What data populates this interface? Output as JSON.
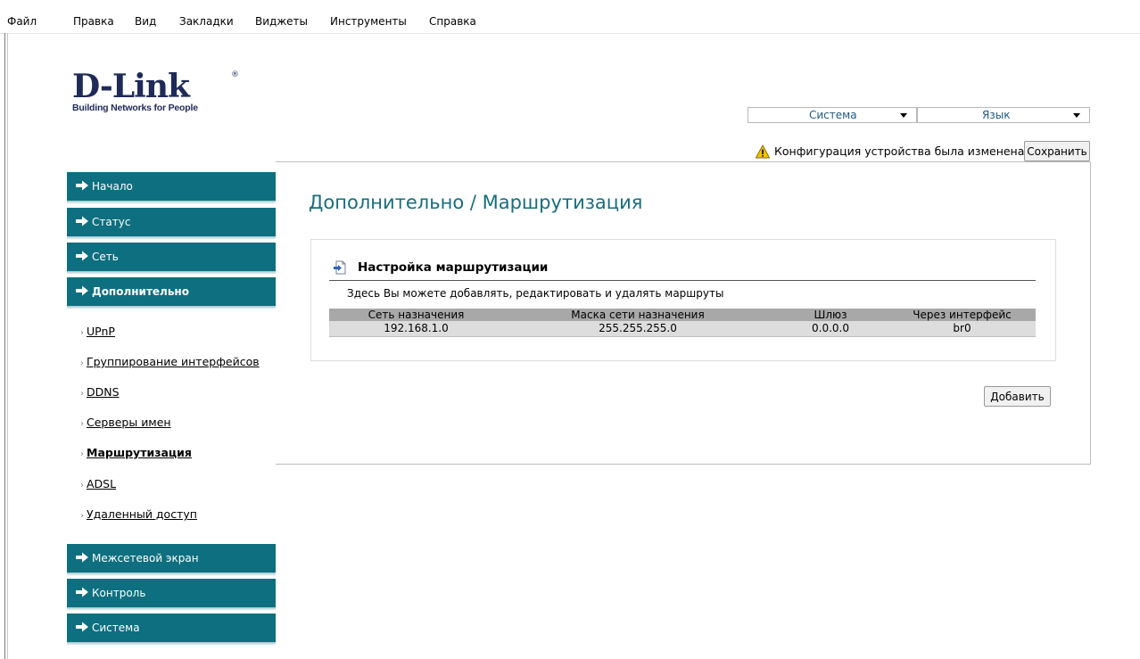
{
  "menubar": [
    "Файл",
    "Правка",
    "Вид",
    "Закладки",
    "Виджеты",
    "Инструменты",
    "Справка"
  ],
  "logo": {
    "brand": "D-Link",
    "reg": "®",
    "tagline": "Building Networks for People"
  },
  "top_selects": {
    "system": "Система",
    "language": "Язык"
  },
  "notice": {
    "text": "Конфигурация устройства была изменена",
    "save_label": "Сохранить"
  },
  "nav": {
    "home": "Начало",
    "status": "Статус",
    "network": "Сеть",
    "advanced": "Дополнительно",
    "firewall": "Межсетевой экран",
    "control": "Контроль",
    "system": "Система"
  },
  "subnav": [
    "UPnP",
    "Группирование интерфейсов",
    "DDNS",
    "Серверы имен",
    "Маршрутизация",
    "ADSL",
    "Удаленный доступ"
  ],
  "page": {
    "title": "Дополнительно /  Маршрутизация",
    "section_title": "Настройка маршрутизации",
    "section_desc": "Здесь Вы можете добавлять, редактировать и удалять маршруты",
    "add_label": "Добавить"
  },
  "routes": {
    "headers": [
      "Сеть назначения",
      "Маска сети назначения",
      "Шлюз",
      "Через интерфейс"
    ],
    "rows": [
      [
        "192.168.1.0",
        "255.255.255.0",
        "0.0.0.0",
        "br0"
      ]
    ]
  },
  "colors": {
    "nav": "#0d6f7f",
    "title": "#166d7d",
    "brand": "#1e2a58"
  }
}
